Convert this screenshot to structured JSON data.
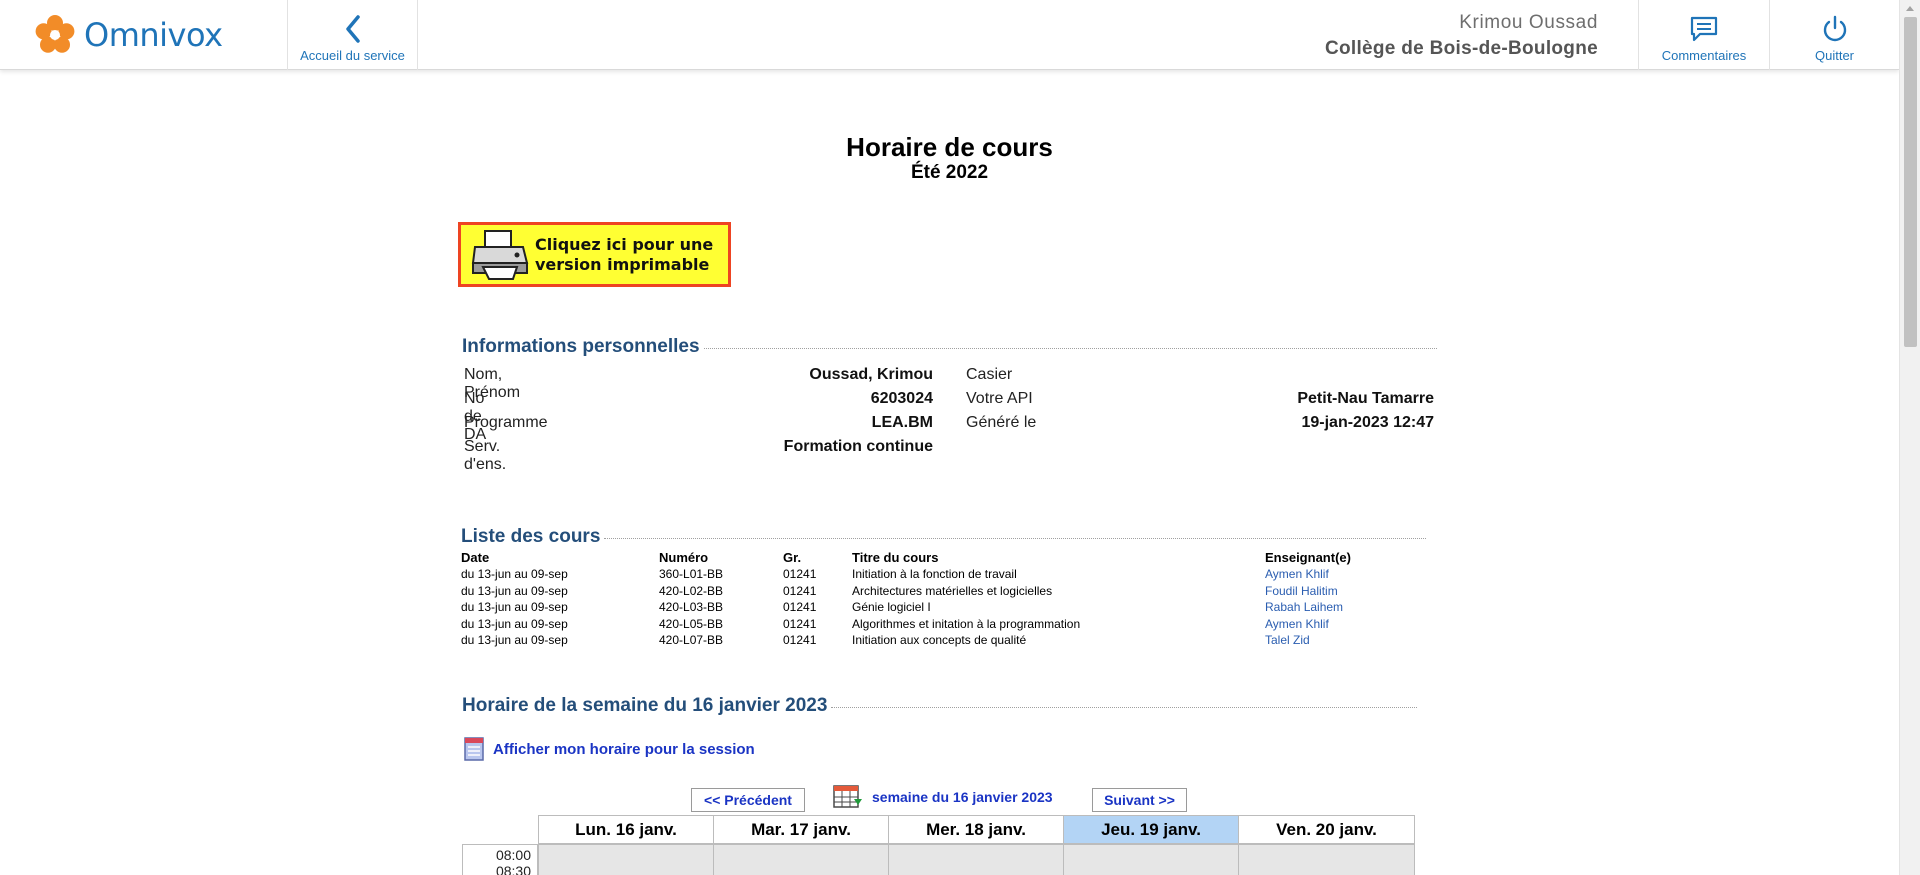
{
  "header": {
    "logo_text": "Omnivox",
    "back_label": "Accueil du service",
    "user_name": "Krimou Oussad",
    "college": "Collège de Bois-de-Boulogne",
    "comments_label": "Commentaires",
    "quit_label": "Quitter",
    "brand_color": "#1f74b8",
    "logo_color": "#f28c28"
  },
  "page": {
    "title": "Horaire de cours",
    "subtitle": "Été 2022",
    "print_banner_line1": "Cliquez ici pour une",
    "print_banner_line2": "version imprimable"
  },
  "personal": {
    "section_title": "Informations personnelles",
    "left": [
      {
        "label": "Nom, Prénom",
        "value": "Oussad, Krimou"
      },
      {
        "label": "No de DA",
        "value": "6203024"
      },
      {
        "label": "Programme",
        "value": "LEA.BM"
      },
      {
        "label": "Serv. d'ens.",
        "value": "Formation continue"
      }
    ],
    "right": [
      {
        "label": "Casier",
        "value": ""
      },
      {
        "label": "Votre API",
        "value": "Petit-Nau Tamarre"
      },
      {
        "label": "Généré le",
        "value": "19-jan-2023 12:47"
      }
    ]
  },
  "courses": {
    "section_title": "Liste des cours",
    "headers": {
      "date": "Date",
      "number": "Numéro",
      "group": "Gr.",
      "title": "Titre du cours",
      "teacher": "Enseignant(e)"
    },
    "rows": [
      {
        "date": "du 13-jun au 09-sep",
        "number": "360-L01-BB",
        "group": "01241",
        "title": "Initiation à la fonction de travail",
        "teacher": "Aymen Khlif"
      },
      {
        "date": "du 13-jun au 09-sep",
        "number": "420-L02-BB",
        "group": "01241",
        "title": "Architectures matérielles et logicielles",
        "teacher": "Foudil Halitim"
      },
      {
        "date": "du 13-jun au 09-sep",
        "number": "420-L03-BB",
        "group": "01241",
        "title": "Génie logiciel I",
        "teacher": "Rabah Laihem"
      },
      {
        "date": "du 13-jun au 09-sep",
        "number": "420-L05-BB",
        "group": "01241",
        "title": "Algorithmes et initation à la programmation",
        "teacher": "Aymen Khlif"
      },
      {
        "date": "du 13-jun au 09-sep",
        "number": "420-L07-BB",
        "group": "01241",
        "title": "Initiation aux concepts de qualité",
        "teacher": "Talel Zid"
      }
    ]
  },
  "week": {
    "section_title": "Horaire de la semaine du 16 janvier 2023",
    "session_link": "Afficher mon horaire pour la session",
    "prev_label": "<< Précédent",
    "next_label": "Suivant >>",
    "week_label": "semaine du 16 janvier 2023",
    "days": [
      "Lun. 16 janv.",
      "Mar. 17 janv.",
      "Mer. 18 janv.",
      "Jeu. 19 janv.",
      "Ven. 20 janv."
    ],
    "today_index": 3,
    "times": [
      "08:00",
      "08:30"
    ]
  }
}
